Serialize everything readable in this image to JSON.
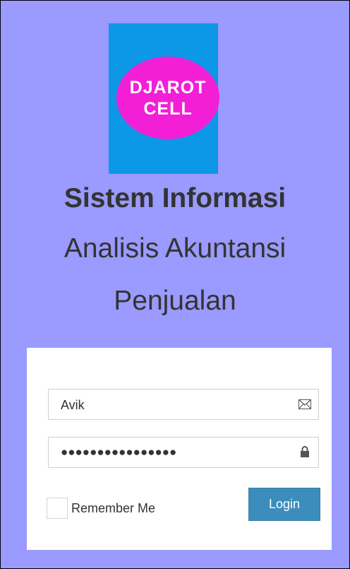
{
  "logo": {
    "line1": "DJAROT",
    "line2": "CELL",
    "colors": {
      "background": "#0c98e6",
      "ellipse": "#f21fd6",
      "text": "#ffffff"
    }
  },
  "page": {
    "background": "#9a9aff",
    "title_line1": "Sistem Informasi",
    "title_line2": "Analisis Akuntansi",
    "title_line3": "Penjualan"
  },
  "login_form": {
    "username": {
      "value": "Avik",
      "icon": "envelope-icon"
    },
    "password": {
      "value_masked": "●●●●●●●●●●●●●●●●",
      "icon": "lock-icon"
    },
    "remember_label": "Remember Me",
    "remember_checked": false,
    "login_label": "Login",
    "login_color": "#3c8dbc"
  }
}
